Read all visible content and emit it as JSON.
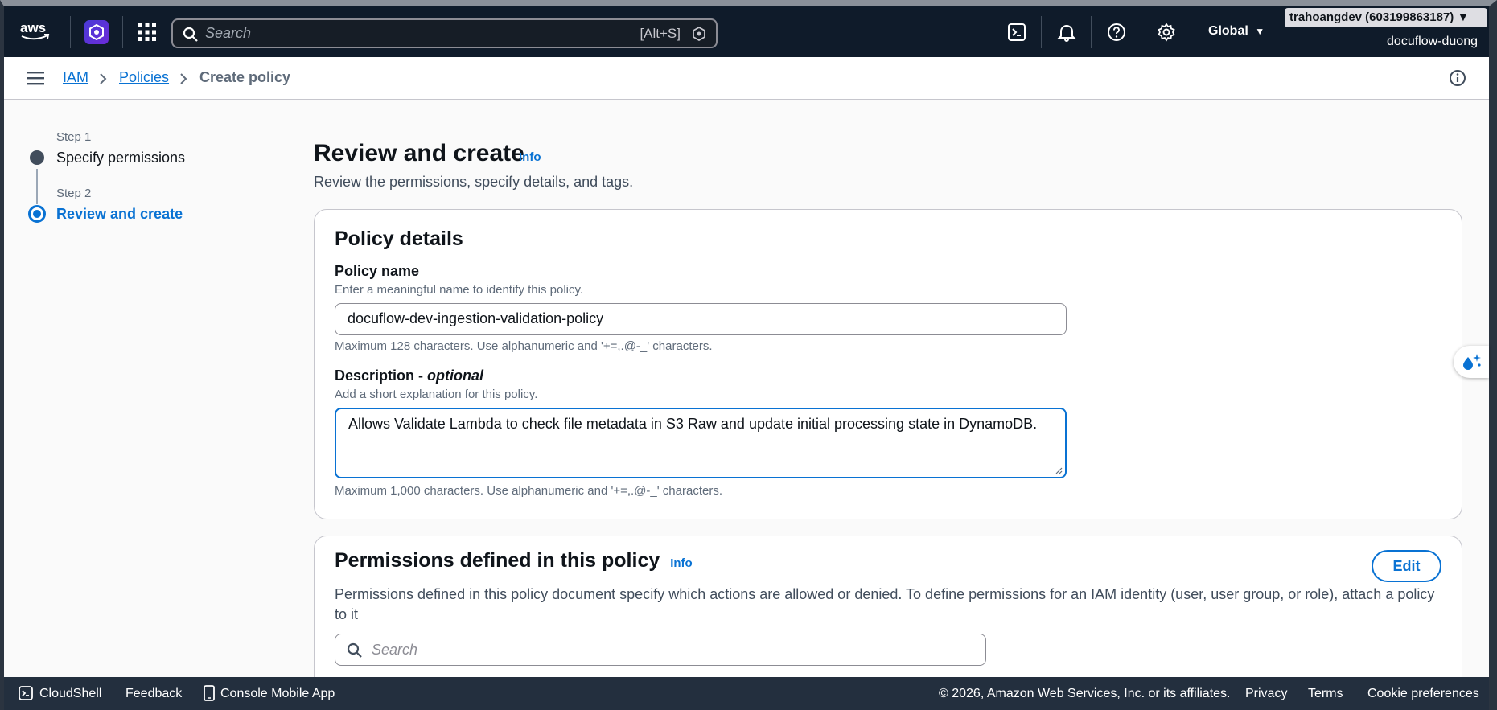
{
  "topnav": {
    "logo": "aws",
    "search_placeholder": "Search",
    "search_shortcut": "[Alt+S]",
    "region": "Global",
    "account": "trahoangdev (603199863187) ▼",
    "user": "docuflow-duong",
    "icons": [
      "aws-logo",
      "app-badge-icon",
      "services-grid-icon",
      "search-icon",
      "cloudshell-icon",
      "bell-icon",
      "help-icon",
      "settings-icon",
      "caret-down-icon"
    ]
  },
  "breadcrumb": {
    "items": [
      "IAM",
      "Policies",
      "Create policy"
    ]
  },
  "steps": [
    {
      "label": "Step 1",
      "title": "Specify permissions"
    },
    {
      "label": "Step 2",
      "title": "Review and create"
    }
  ],
  "page": {
    "title": "Review and create",
    "info": "Info",
    "subtitle": "Review the permissions, specify details, and tags."
  },
  "policy_details": {
    "title": "Policy details",
    "name_label": "Policy name",
    "name_desc": "Enter a meaningful name to identify this policy.",
    "name_value": "docuflow-dev-ingestion-validation-policy",
    "name_constraint": "Maximum 128 characters. Use alphanumeric and '+=,.@-_' characters.",
    "desc_label": "Description -",
    "desc_optional": "optional",
    "desc_desc": "Add a short explanation for this policy.",
    "desc_value": "Allows Validate Lambda to check file metadata in S3 Raw and update initial processing state in DynamoDB.",
    "desc_constraint": "Maximum 1,000 characters. Use alphanumeric and '+=,.@-_' characters."
  },
  "permissions": {
    "title": "Permissions defined in this policy",
    "info": "Info",
    "edit": "Edit",
    "description": "Permissions defined in this policy document specify which actions are allowed or denied. To define permissions for an IAM identity (user, user group, or role), attach a policy to it",
    "search_placeholder": "Search"
  },
  "footer": {
    "cloudshell": "CloudShell",
    "feedback": "Feedback",
    "mobile": "Console Mobile App",
    "copyright": "© 2026, Amazon Web Services, Inc. or its affiliates.",
    "privacy": "Privacy",
    "terms": "Terms",
    "cookies": "Cookie preferences"
  },
  "colors": {
    "nav_bg": "#0f1b2a",
    "accent": "#0972d3",
    "footer_bg": "#232f3e"
  }
}
